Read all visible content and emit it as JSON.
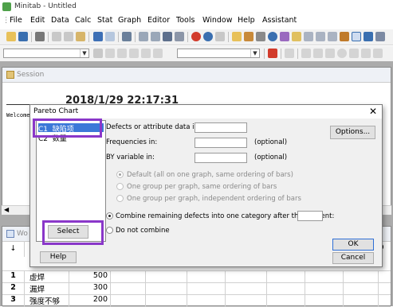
{
  "window": {
    "title": "Minitab - Untitled"
  },
  "menu": [
    "File",
    "Edit",
    "Data",
    "Calc",
    "Stat",
    "Graph",
    "Editor",
    "Tools",
    "Window",
    "Help",
    "Assistant"
  ],
  "session": {
    "title": "Session",
    "date": "2018/1/29 22:17:31",
    "welcome": "Welcome"
  },
  "worksheet": {
    "title": "Wo",
    "header_arrow": "↓",
    "col9": "9",
    "rows": [
      {
        "num": "1",
        "label": "虚焊",
        "value": "500"
      },
      {
        "num": "2",
        "label": "漏焊",
        "value": "300"
      },
      {
        "num": "3",
        "label": "强度不够",
        "value": "200"
      }
    ]
  },
  "dialog": {
    "title": "Pareto Chart",
    "close": "✕",
    "variables": [
      {
        "id": "C1",
        "name": "缺陷项"
      },
      {
        "id": "C2",
        "name": "数量"
      }
    ],
    "defects_label": "Defects or attribute data in:",
    "freq_label": "Frequencies in:",
    "freq_optional": "(optional)",
    "by_label": "BY variable in:",
    "by_optional": "(optional)",
    "options_btn": "Options...",
    "opt_default": "Default (all on one graph, same ordering of bars)",
    "opt_one_group": "One group per graph, same ordering of bars",
    "opt_indep": "One group per graph, independent ordering of bars",
    "combine_label": "Combine remaining defects into one category after this percent:",
    "no_combine_label": "Do not combine",
    "select_btn": "Select",
    "help_btn": "Help",
    "ok_btn": "OK",
    "cancel_btn": "Cancel"
  },
  "colors": {
    "highlight": "#8a37c9",
    "selection": "#3c78d8"
  }
}
